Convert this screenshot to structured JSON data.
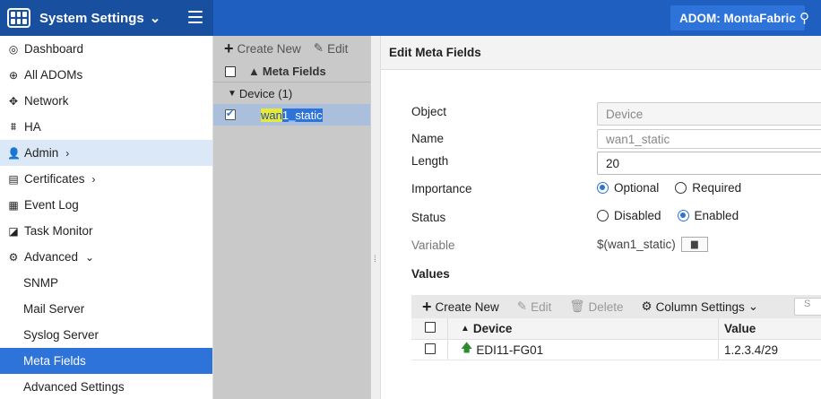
{
  "topbar": {
    "title": "System Settings",
    "adom_label": "ADOM: MontaFabric"
  },
  "sidebar": {
    "items": [
      {
        "label": "Dashboard",
        "icon": "dashboard-icon"
      },
      {
        "label": "All ADOMs",
        "icon": "globe-icon"
      },
      {
        "label": "Network",
        "icon": "network-icon"
      },
      {
        "label": "HA",
        "icon": "ha-icon"
      },
      {
        "label": "Admin",
        "icon": "user-icon"
      },
      {
        "label": "Certificates",
        "icon": "certificate-icon"
      },
      {
        "label": "Event Log",
        "icon": "event-log-icon"
      },
      {
        "label": "Task Monitor",
        "icon": "task-monitor-icon"
      },
      {
        "label": "Advanced",
        "icon": "advanced-icon"
      },
      {
        "label": "SNMP"
      },
      {
        "label": "Mail Server"
      },
      {
        "label": "Syslog Server"
      },
      {
        "label": "Meta Fields"
      },
      {
        "label": "Advanced Settings"
      }
    ]
  },
  "tree": {
    "create_new": "Create New",
    "edit": "Edit",
    "header": "Meta Fields",
    "group": "Device (1)",
    "row_match": "wan",
    "row_rest": "1_static"
  },
  "edit": {
    "title": "Edit Meta Fields",
    "object_label": "Object",
    "object_value": "Device",
    "name_label": "Name",
    "name_value": "wan1_static",
    "length_label": "Length",
    "length_value": "20",
    "importance_label": "Importance",
    "importance_options": [
      "Optional",
      "Required"
    ],
    "importance_selected": "Optional",
    "status_label": "Status",
    "status_options": [
      "Disabled",
      "Enabled"
    ],
    "status_selected": "Enabled",
    "variable_label": "Variable",
    "variable_value": "$(wan1_static)",
    "values_title": "Values"
  },
  "values_grid": {
    "toolbar": {
      "create_new": "Create New",
      "edit": "Edit",
      "delete": "Delete",
      "column_settings": "Column Settings"
    },
    "columns": [
      "Device",
      "Value"
    ],
    "rows": [
      {
        "device": "EDI11-FG01",
        "value": "1.2.3.4/29"
      }
    ]
  },
  "colors": {
    "topbar": "#1f5fbf",
    "accent": "#2d73d9",
    "tree_panel": "#c9c9c9",
    "selected_row": "#a9bfdc",
    "search_highlight": "#e8e83a"
  }
}
